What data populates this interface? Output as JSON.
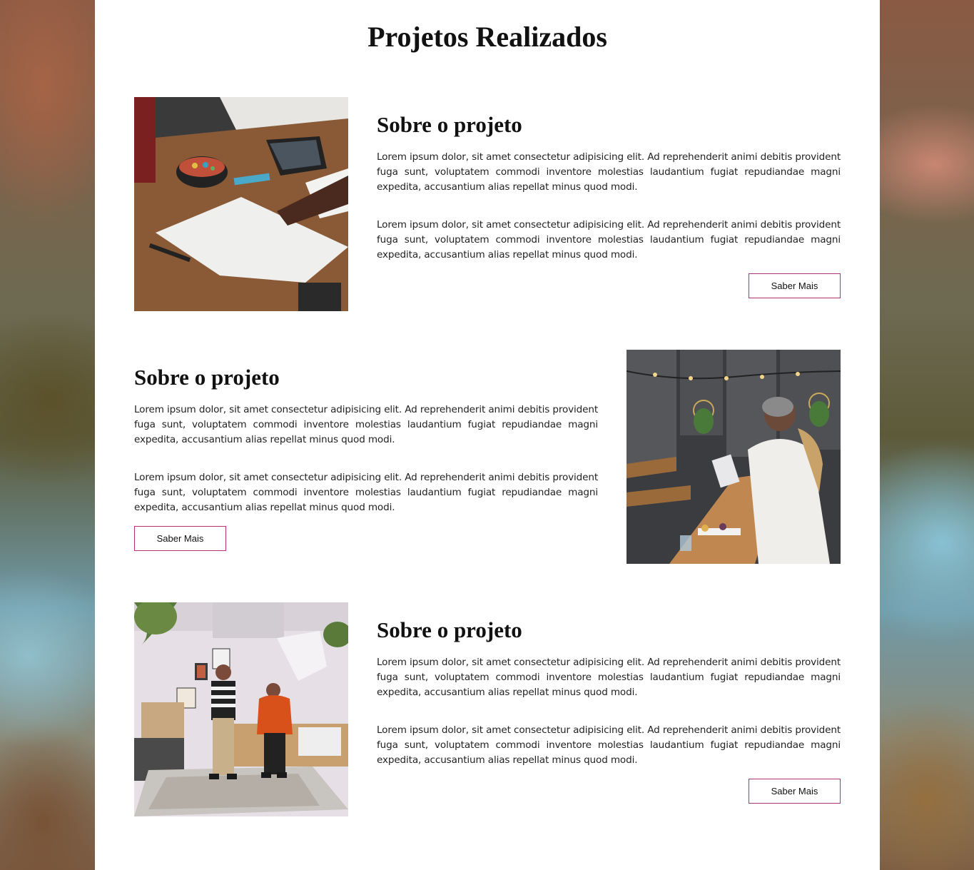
{
  "page": {
    "title": "Projetos Realizados"
  },
  "projects": [
    {
      "title": "Sobre o projeto",
      "paragraph1": "Lorem ipsum dolor, sit amet consectetur adipisicing elit. Ad reprehenderit animi debitis provident fuga sunt, voluptatem commodi inventore molestias laudantium fugiat repudiandae magni expedita, accusantium alias repellat minus quod modi.",
      "paragraph2": "Lorem ipsum dolor, sit amet consectetur adipisicing elit. Ad reprehenderit animi debitis provident fuga sunt, voluptatem commodi inventore molestias laudantium fugiat repudiandae magni expedita, accusantium alias repellat minus quod modi.",
      "button_label": "Saber Mais",
      "image": "desk-with-blueprints-photo"
    },
    {
      "title": "Sobre o projeto",
      "paragraph1": "Lorem ipsum dolor, sit amet consectetur adipisicing elit. Ad reprehenderit animi debitis provident fuga sunt, voluptatem commodi inventore molestias laudantium fugiat repudiandae magni expedita, accusantium alias repellat minus quod modi.",
      "paragraph2": "Lorem ipsum dolor, sit amet consectetur adipisicing elit. Ad reprehenderit animi debitis provident fuga sunt, voluptatem commodi inventore molestias laudantium fugiat repudiandae magni expedita, accusantium alias repellat minus quod modi.",
      "button_label": "Saber Mais",
      "image": "people-at-cafe-table-photo"
    },
    {
      "title": "Sobre o projeto",
      "paragraph1": "Lorem ipsum dolor, sit amet consectetur adipisicing elit. Ad reprehenderit animi debitis provident fuga sunt, voluptatem commodi inventore molestias laudantium fugiat repudiandae magni expedita, accusantium alias repellat minus quod modi.",
      "paragraph2": "Lorem ipsum dolor, sit amet consectetur adipisicing elit. Ad reprehenderit animi debitis provident fuga sunt, voluptatem commodi inventore molestias laudantium fugiat repudiandae magni expedita, accusantium alias repellat minus quod modi.",
      "button_label": "Saber Mais",
      "image": "two-people-in-studio-photo"
    }
  ],
  "colors": {
    "button_border": "#b0307a",
    "page_background": "#ffffff"
  }
}
